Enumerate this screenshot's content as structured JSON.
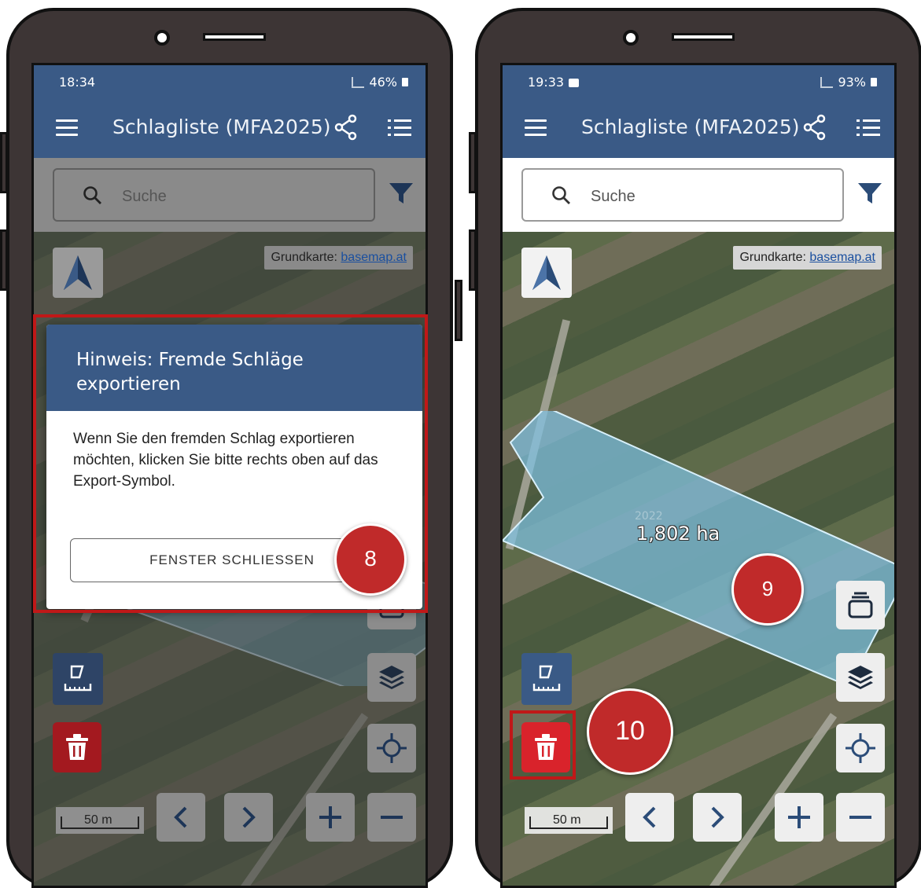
{
  "left_phone": {
    "status": {
      "time": "18:34",
      "battery": "46%"
    },
    "appbar": {
      "title": "Schlagliste (MFA2025)"
    },
    "search": {
      "placeholder": "Suche"
    },
    "attribution": {
      "prefix": "Grundkarte:",
      "link": "basemap.at"
    },
    "dialog": {
      "title": "Hinweis: Fremde Schläge exportieren",
      "body": "Wenn Sie den fremden Schlag exportieren möchten, klicken Sie bitte rechts oben auf das Export-Symbol.",
      "close_label": "FENSTER SCHLIESSEN"
    },
    "scale": "50 m",
    "callout": "8"
  },
  "right_phone": {
    "status": {
      "time": "19:33",
      "battery": "93%"
    },
    "appbar": {
      "title": "Schlagliste (MFA2025)"
    },
    "search": {
      "placeholder": "Suche"
    },
    "attribution": {
      "prefix": "Grundkarte:",
      "link": "basemap.at"
    },
    "field": {
      "area": "1,802 ha",
      "year": "2022"
    },
    "scale": "50 m",
    "callout_layers": "9",
    "callout_delete": "10"
  },
  "colors": {
    "primary": "#3a5a86",
    "danger": "#d9232b",
    "callout": "#c02a2a",
    "field": "#7fc3e6"
  },
  "icons": [
    "menu-icon",
    "share-icon",
    "list-icon",
    "search-icon",
    "filter-icon",
    "north-arrow-icon",
    "layers-icon",
    "stack-icon",
    "locate-icon",
    "ruler-icon",
    "trash-icon",
    "chevron-left-icon",
    "chevron-right-icon",
    "plus-icon",
    "minus-icon"
  ]
}
